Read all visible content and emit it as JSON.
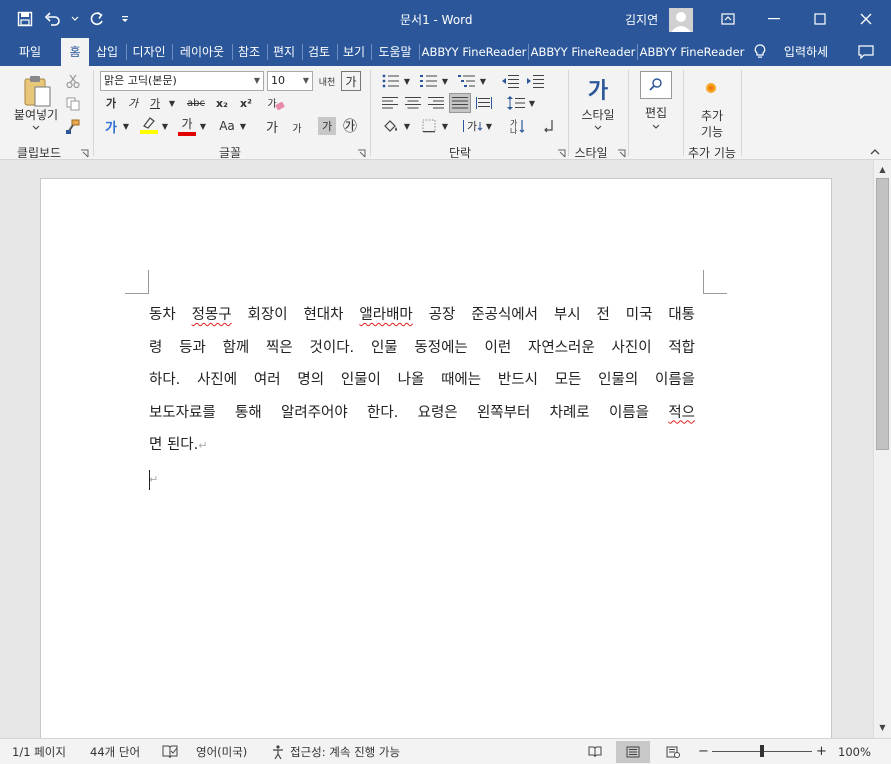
{
  "window": {
    "title": "문서1 - Word",
    "user": "김지연",
    "controls": {
      "ribbon_display": "ribbon-display-icon",
      "minimize": "minimize-icon",
      "maximize": "maximize-icon",
      "close": "close-icon"
    }
  },
  "qat": {
    "save": "save-icon",
    "undo": "undo-icon",
    "redo": "redo-icon",
    "customize": "qat-customize-icon"
  },
  "tabs": [
    {
      "label": "파일"
    },
    {
      "label": "홈"
    },
    {
      "label": "삽입"
    },
    {
      "label": "디자인"
    },
    {
      "label": "레이아웃"
    },
    {
      "label": "참조"
    },
    {
      "label": "편지"
    },
    {
      "label": "검토"
    },
    {
      "label": "보기"
    },
    {
      "label": "도움말"
    },
    {
      "label": "ABBYY FineReader"
    },
    {
      "label": "ABBYY FineReader"
    },
    {
      "label": "ABBYY FineReader"
    }
  ],
  "tell_me": "입력하세",
  "ribbon": {
    "clipboard": {
      "label": "클립보드",
      "paste": "붙여넣기"
    },
    "font": {
      "label": "글꼴",
      "font_name": "맑은 고딕(본문)",
      "font_size": "10"
    },
    "paragraph": {
      "label": "단락"
    },
    "styles": {
      "label": "스타일",
      "button": "스타일",
      "glyph": "가"
    },
    "editing": {
      "button": "편집"
    },
    "addins": {
      "label": "추가 기능",
      "button_line1": "추가",
      "button_line2": "기능"
    }
  },
  "font_glyphs": {
    "bold": "가",
    "italic": "가",
    "underline": "가",
    "strike": "abc",
    "sub": "x₂",
    "sup": "x²",
    "clear": "가",
    "phonetic": "내천",
    "border": "가",
    "case": "Aa",
    "grow": "가",
    "shrink": "가",
    "shade": "가",
    "enclose": "㉮"
  },
  "document": {
    "lines": [
      [
        "동차 ",
        "정몽구",
        " 회장이 현대차 ",
        "앨라배마",
        " 공장 준공식에서 부시 전 미국 대통"
      ],
      [
        "령 등과 함께 찍은 것이다. 인물 동정에는 이런 자연스러운 사진이 적합"
      ],
      [
        "하다. 사진에 여러 명의 인물이 나올 때에는 반드시 모든 인물의 이름을"
      ],
      [
        "보도자료를 통해 알려주어야 한다. 요령은 왼쪽부터 차례로 이름을 ",
        "적으"
      ],
      [
        "면 된다."
      ]
    ]
  },
  "status": {
    "page": "1/1 페이지",
    "words": "44개 단어",
    "language": "영어(미국)",
    "accessibility": "접근성: 계속 진행 가능",
    "zoom": "100%",
    "zoom_minus": "−",
    "zoom_plus": "+"
  },
  "colors": {
    "accent": "#2b579a",
    "highlight": "#ffff00",
    "font_color": "#e00000"
  }
}
